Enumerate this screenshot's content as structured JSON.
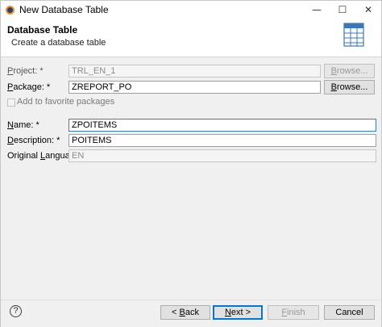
{
  "window": {
    "title": "New Database Table"
  },
  "banner": {
    "title": "Database Table",
    "subtitle": "Create a database table",
    "icon": "table-icon"
  },
  "form": {
    "project": {
      "label": "Project: *",
      "value": "TRL_EN_1",
      "browse": "Browse..."
    },
    "package": {
      "label": "Package: *",
      "value": "ZREPORT_PO",
      "browse": "Browse..."
    },
    "favorite": {
      "label": "Add to favorite packages",
      "checked": false
    },
    "name": {
      "label": "Name: *",
      "value": "ZPOITEMS"
    },
    "description": {
      "label": "Description: *",
      "value": "POITEMS"
    },
    "original_language": {
      "label": "Original Language:",
      "value": "EN"
    }
  },
  "buttons": {
    "help": "?",
    "back": "< Back",
    "next": "Next >",
    "finish": "Finish",
    "cancel": "Cancel"
  },
  "colors": {
    "focus_border": "#3c7fb1",
    "form_background": "#f0f0f0",
    "default_button_border": "#0078d7"
  }
}
